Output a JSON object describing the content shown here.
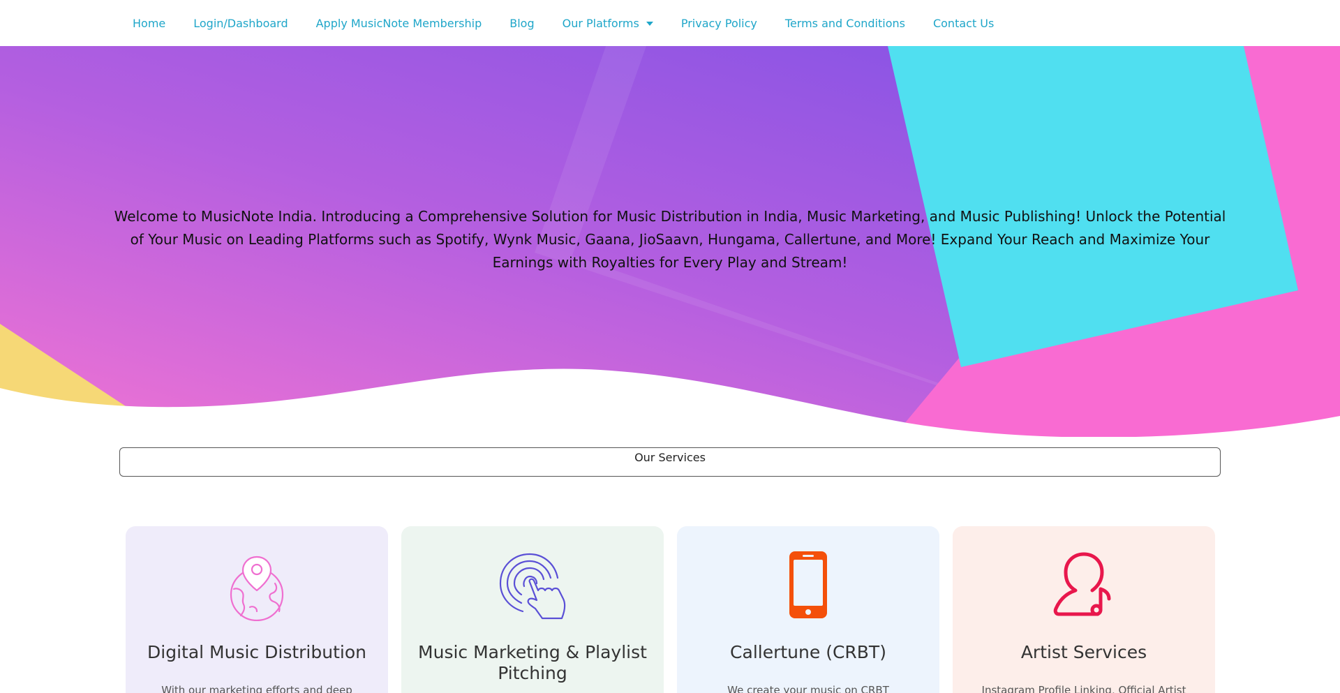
{
  "nav": {
    "items": [
      {
        "label": "Home"
      },
      {
        "label": "Login/Dashboard"
      },
      {
        "label": "Apply MusicNote Membership"
      },
      {
        "label": "Blog"
      },
      {
        "label": "Our Platforms"
      },
      {
        "label": "Privacy Policy"
      },
      {
        "label": "Terms and Conditions"
      },
      {
        "label": "Contact Us"
      }
    ],
    "color": "#1fa6c9"
  },
  "hero": {
    "text": "Welcome to MusicNote India. Introducing a Comprehensive Solution for Music Distribution in India, Music Marketing, and Music Publishing! Unlock the Potential of Your Music on Leading Platforms such as Spotify, Wynk Music, Gaana, JioSaavn, Hungama, Callertune, and More! Expand Your Reach and Maximize Your Earnings with Royalties for Every Play and Stream!",
    "colors": {
      "gradient_start": "#e56fd6",
      "gradient_end": "#7e52e6",
      "cyan": "#50dff0",
      "pink": "#f96bd2",
      "yellow": "#f6d876"
    }
  },
  "services": {
    "title": "Our Services",
    "cards": [
      {
        "title": "Digital Music Distribution",
        "text": "With our marketing efforts and deep",
        "icon": "globe-pin-icon",
        "bg": "#efecfa",
        "icon_color": "#ef6fd0"
      },
      {
        "title": "Music Marketing & Playlist Pitching",
        "text": "",
        "icon": "touch-tap-icon",
        "bg": "#edf5f0",
        "icon_color": "#5a4fd6"
      },
      {
        "title": "Callertune (CRBT)",
        "text": "We create your music on CRBT (callertune)",
        "icon": "mobile-phone-icon",
        "bg": "#edf4fd",
        "icon_color": "#f4500a"
      },
      {
        "title": "Artist Services",
        "text": "Instagram Profile Linking, Official Artist",
        "icon": "artist-note-icon",
        "bg": "#fdeeea",
        "icon_color": "#e8174c"
      }
    ]
  }
}
